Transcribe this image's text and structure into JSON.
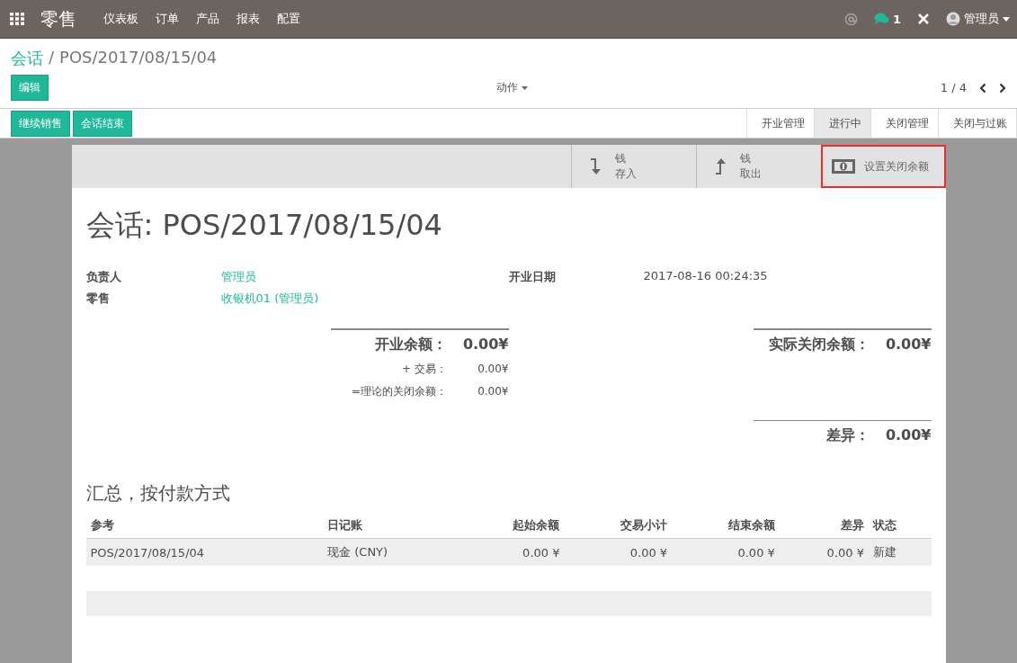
{
  "navbar": {
    "app_title": "零售",
    "menu": [
      "仪表板",
      "订单",
      "产品",
      "报表",
      "配置"
    ],
    "chat_count": "1",
    "user": "管理员"
  },
  "breadcrumb": {
    "parent": "会话",
    "separator": "/",
    "current": "POS/2017/08/15/04"
  },
  "control_panel": {
    "edit_button": "编辑",
    "action_menu": "动作",
    "pager": "1 / 4"
  },
  "header_buttons": [
    "继续销售",
    "会话结束"
  ],
  "status_steps": [
    {
      "label": "开业管理",
      "selected": false
    },
    {
      "label": "进行中",
      "selected": true
    },
    {
      "label": "关闭管理",
      "selected": false
    },
    {
      "label": "关闭与过账",
      "selected": false
    }
  ],
  "button_box": [
    {
      "kind": "in",
      "line1": "钱",
      "line2": "存入",
      "highlighted": false
    },
    {
      "kind": "out",
      "line1": "钱",
      "line2": "取出",
      "highlighted": false
    },
    {
      "kind": "cash",
      "line1": "设置关闭余额",
      "highlighted": true
    }
  ],
  "title": "会话: POS/2017/08/15/04",
  "fields_left": [
    {
      "label": "负责人",
      "value": "管理员"
    },
    {
      "label": "零售",
      "value": "收银机01 (管理员)"
    }
  ],
  "fields_right": [
    {
      "label": "开业日期",
      "value": "2017-08-16 00:24:35"
    }
  ],
  "opening": {
    "main": {
      "label": "开业余额：",
      "value": "0.00¥"
    },
    "rows": [
      {
        "label": "+ 交易：",
        "value": "0.00¥"
      },
      {
        "label": "=理论的关闭余额：",
        "value": "0.00¥"
      }
    ]
  },
  "closing": {
    "actual": {
      "label": "实际关闭余额：",
      "value": "0.00¥"
    },
    "difference": {
      "label": "差异：",
      "value": "0.00¥"
    }
  },
  "summary_title": "汇总，按付款方式",
  "table": {
    "columns": [
      "参考",
      "日记账",
      "起始余额",
      "交易小计",
      "结束余额",
      "差异",
      "状态"
    ],
    "rows": [
      [
        "POS/2017/08/15/04",
        "现金 (CNY)",
        "0.00 ¥",
        "0.00 ¥",
        "0.00 ¥",
        "0.00 ¥",
        "新建"
      ]
    ]
  }
}
